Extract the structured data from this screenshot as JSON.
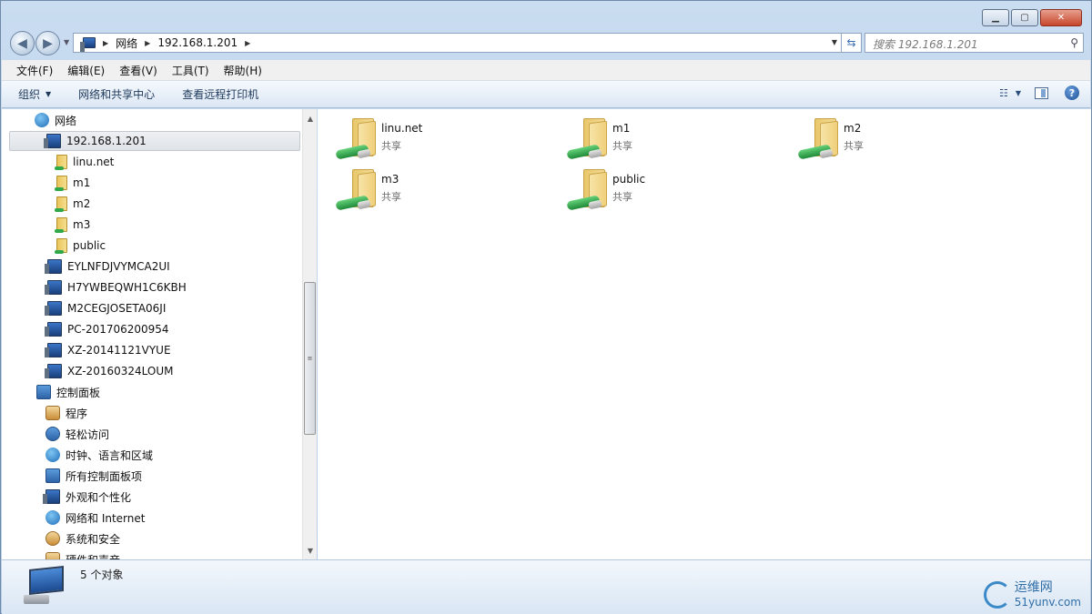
{
  "address": {
    "crumbs": [
      "网络",
      "192.168.1.201"
    ]
  },
  "search": {
    "placeholder": "搜索 192.168.1.201"
  },
  "menubar": {
    "items": [
      "文件(F)",
      "编辑(E)",
      "查看(V)",
      "工具(T)",
      "帮助(H)"
    ]
  },
  "cmdbar": {
    "organize": "组织",
    "network_center": "网络和共享中心",
    "remote_printers": "查看远程打印机"
  },
  "nav": {
    "network": "网络",
    "host": "192.168.1.201",
    "shares": [
      "linu.net",
      "m1",
      "m2",
      "m3",
      "public"
    ],
    "computers": [
      "EYLNFDJVYMCA2UI",
      "H7YWBEQWH1C6KBH",
      "M2CEGJOSETA06JI",
      "PC-201706200954",
      "XZ-20141121VYUE",
      "XZ-20160324LOUM"
    ],
    "control_panel": "控制面板",
    "cp_items": [
      "程序",
      "轻松访问",
      "时钟、语言和区域",
      "所有控制面板项",
      "外观和个性化",
      "网络和 Internet",
      "系统和安全",
      "硬件和声音"
    ]
  },
  "content": {
    "items": [
      {
        "name": "linu.net",
        "sub": "共享"
      },
      {
        "name": "m1",
        "sub": "共享"
      },
      {
        "name": "m2",
        "sub": "共享"
      },
      {
        "name": "m3",
        "sub": "共享"
      },
      {
        "name": "public",
        "sub": "共享"
      }
    ]
  },
  "details": {
    "count": "5 个对象"
  },
  "watermark": {
    "line1": "运维网",
    "line2": "51yunv.com"
  },
  "colors": {
    "accent": "#3c89c9",
    "selection": "#dfe3e8"
  }
}
